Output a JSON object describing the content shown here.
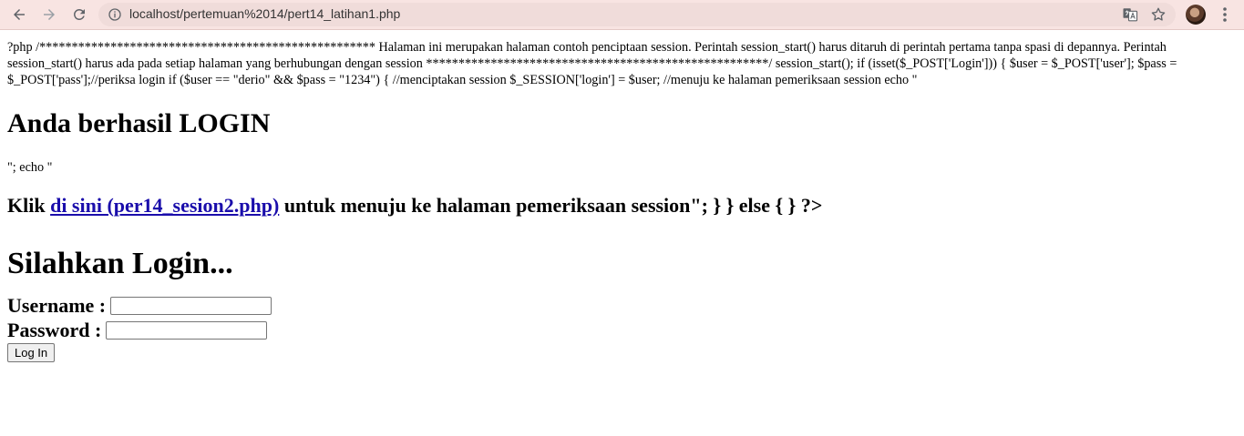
{
  "browser": {
    "url": "localhost/pertemuan%2014/pert14_latihan1.php"
  },
  "page": {
    "php_text": "?php /**************************************************** Halaman ini merupakan halaman contoh penciptaan session. Perintah session_start() harus ditaruh di perintah pertama tanpa spasi di depannya. Perintah session_start() harus ada pada setiap halaman yang berhubungan dengan session *****************************************************/ session_start(); if (isset($_POST['Login'])) { $user = $_POST['user']; $pass = $_POST['pass'];//periksa login if ($user == \"derio\" && $pass = \"1234\") { //menciptakan session $_SESSION['login'] = $user; //menuju ke halaman pemeriksaan session echo \"",
    "success_heading": "Anda berhasil LOGIN",
    "echo_text": "\"; echo \"",
    "klik_prefix": "Klik ",
    "klik_link": "di sini (per14_sesion2.php)",
    "klik_suffix": " untuk menuju ke halaman pemeriksaan session\"; } } else { } ?>",
    "login_heading": "Silahkan Login...",
    "username_label": "Username :",
    "password_label": "Password :",
    "submit_label": "Log In"
  }
}
